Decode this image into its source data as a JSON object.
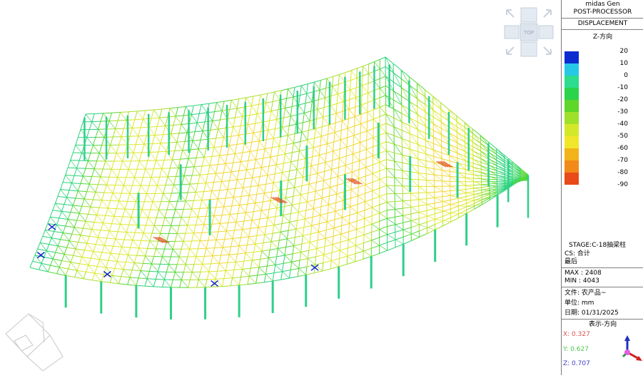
{
  "panel": {
    "app_name": "midas Gen",
    "module": "POST-PROCESSOR",
    "result_type": "DISPLACEMENT",
    "component": "Z-方向",
    "legend": {
      "values": [
        "20",
        "10",
        "0",
        "-10",
        "-20",
        "-30",
        "-40",
        "-50",
        "-60",
        "-70",
        "-80",
        "-90"
      ],
      "colors": [
        "#0a2bcf",
        "#27c8e6",
        "#2ddc8e",
        "#2ad44a",
        "#5ed62a",
        "#9ee02a",
        "#d4e82a",
        "#f2e62a",
        "#f2b21a",
        "#f28a1a",
        "#e84a1a"
      ]
    },
    "stage": "STAGE:C-18抽梁柱",
    "cs": "CS: 合计",
    "step": "最后",
    "max": "MAX : 2408",
    "min": "MIN : 4043",
    "file": "文件: 农产品~",
    "unit": "单位: mm",
    "date": "日期: 01/31/2025",
    "view_dir": "表示-方向",
    "vx": "X: 0.327",
    "vy": "Y: 0.627",
    "vz": "Z: 0.707",
    "vx_color": "#e05050",
    "vy_color": "#4ec84e",
    "vz_color": "#4040c8"
  },
  "view_cube": {
    "top_label": "TOP"
  }
}
